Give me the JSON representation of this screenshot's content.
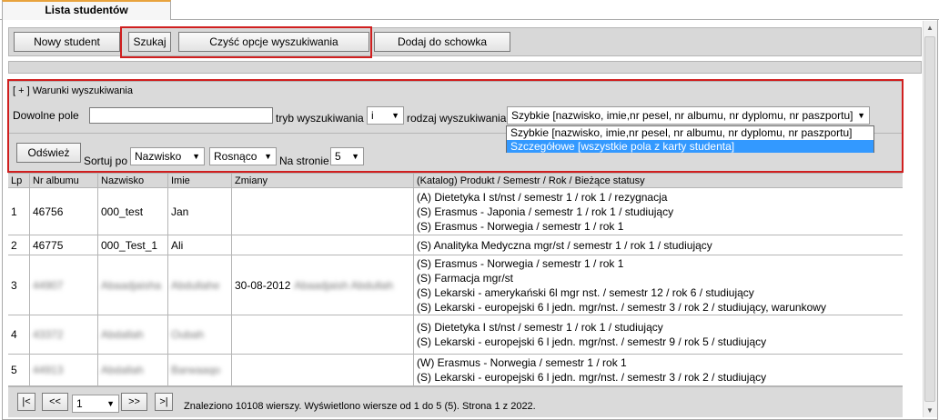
{
  "tab": {
    "label": "Lista studentów"
  },
  "toolbar": {
    "new_student": "Nowy student",
    "search": "Szukaj",
    "clear_search": "Czyść opcje wyszukiwania",
    "add_to_clipboard": "Dodaj do schowka"
  },
  "search": {
    "header": "[ + ] Warunki wyszukiwania",
    "any_field_label": "Dowolne pole",
    "any_field_value": "",
    "mode_label": "tryb wyszukiwania",
    "mode_value": "i",
    "kind_label": "rodzaj wyszukiwania",
    "kind_value": "Szybkie [nazwisko, imie,nr pesel, nr albumu, nr dyplomu, nr paszportu]",
    "kind_options": [
      "Szybkie [nazwisko, imie,nr pesel, nr albumu, nr dyplomu, nr paszportu]",
      "Szczegółowe [wszystkie pola z karty studenta]"
    ],
    "refresh": "Odśwież",
    "sort_label": "Sortuj po",
    "sort_field": "Nazwisko",
    "sort_order": "Rosnąco",
    "per_page_label": "Na stronie",
    "per_page": "5"
  },
  "table": {
    "columns": [
      "Lp",
      "Nr albumu",
      "Nazwisko",
      "Imie",
      "Zmiany",
      "(Katalog) Produkt / Semestr / Rok / Bieżące statusy"
    ],
    "rows": [
      {
        "lp": "1",
        "album": "46756",
        "surname": "000_test",
        "name": "Jan",
        "changes": "",
        "changes_extra": "",
        "products": [
          "(A) Dietetyka I st/nst / semestr 1 / rok 1 / rezygnacja",
          "(S) Erasmus - Japonia / semestr 1 / rok 1 / studiujący",
          "(S) Erasmus - Norwegia / semestr 1 / rok 1"
        ]
      },
      {
        "lp": "2",
        "album": "46775",
        "surname": "000_Test_1",
        "name": "Ali",
        "changes": "",
        "changes_extra": "",
        "products": [
          "(S) Analityka Medyczna mgr/st / semestr 1 / rok 1 / studiujący"
        ]
      },
      {
        "lp": "3",
        "album": "44907",
        "surname": "Abaadjaisha",
        "name": "Abdullahe",
        "changes": "30-08-2012",
        "changes_extra": "Abaadjaish Abdullah",
        "products": [
          "(S) Erasmus - Norwegia / semestr 1 / rok 1",
          "(S) Farmacja mgr/st",
          "(S) Lekarski - amerykański 6l mgr nst. / semestr 12 / rok 6 / studiujący",
          "(S) Lekarski - europejski 6 l jedn. mgr/nst. / semestr 3 / rok 2 / studiujący, warunkowy"
        ]
      },
      {
        "lp": "4",
        "album": "43372",
        "surname": "Abdallah",
        "name": "Oubah",
        "changes": "",
        "changes_extra": "",
        "products": [
          "(S) Dietetyka I st/nst / semestr 1 / rok 1 / studiujący",
          "(S) Lekarski - europejski 6 l jedn. mgr/nst. / semestr 9 / rok 5 / studiujący"
        ]
      },
      {
        "lp": "5",
        "album": "44913",
        "surname": "Abdallah",
        "name": "Barwaaqo",
        "changes": "",
        "changes_extra": "",
        "products": [
          "(W) Erasmus - Norwegia / semestr 1 / rok 1",
          "(S) Lekarski - europejski 6 l jedn. mgr/nst. / semestr 3 / rok 2 / studiujący"
        ]
      }
    ]
  },
  "pager": {
    "first": "|<",
    "prev": "<<",
    "page": "1",
    "next": ">>",
    "last": ">|",
    "summary": "Znaleziono 10108 wierszy. Wyświetlono wiersze od 1 do 5 (5). Strona 1 z 2022."
  },
  "colors": {
    "highlight_box": "#d01f1f",
    "tab_accent": "#e8a33d",
    "selected_option": "#3399ff"
  }
}
